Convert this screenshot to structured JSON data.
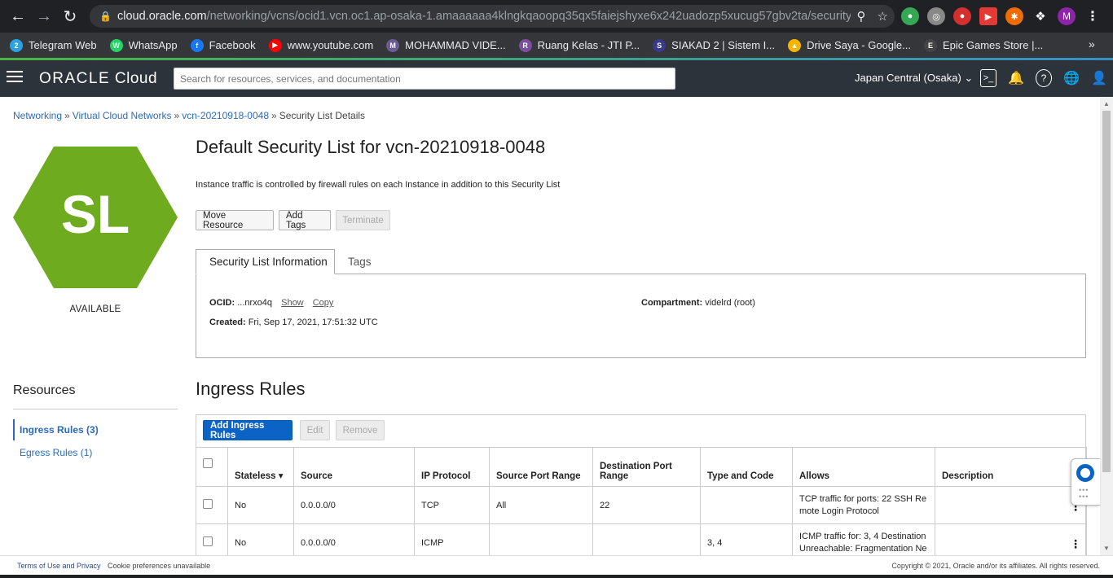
{
  "browser": {
    "url_host": "cloud.oracle.com",
    "url_path": "/networking/vcns/ocid1.vcn.oc1.ap-osaka-1.amaaaaaa4klngkqaoopq35qx5faiejshyxe6x242uadozp5xucug57gbv2ta/security-li...",
    "profile_initial": "M",
    "bookmarks": [
      {
        "label": "Telegram Web",
        "color": "#2aa3df",
        "glyph": "2"
      },
      {
        "label": "WhatsApp",
        "color": "#25d366",
        "glyph": "W"
      },
      {
        "label": "Facebook",
        "color": "#1877f2",
        "glyph": "f"
      },
      {
        "label": "www.youtube.com",
        "color": "#ff0000",
        "glyph": "▶"
      },
      {
        "label": "MOHAMMAD VIDE...",
        "color": "#6b5b95",
        "glyph": "M"
      },
      {
        "label": "Ruang Kelas - JTI P...",
        "color": "#7b4fa0",
        "glyph": "R"
      },
      {
        "label": "SIAKAD 2 | Sistem I...",
        "color": "#3a3a8a",
        "glyph": "S"
      },
      {
        "label": "Drive Saya - Google...",
        "color": "#f4b400",
        "glyph": "▲"
      },
      {
        "label": "Epic Games Store |...",
        "color": "#444",
        "glyph": "E"
      }
    ]
  },
  "header": {
    "logo_main": "ORACLE",
    "logo_sub": "Cloud",
    "search_placeholder": "Search for resources, services, and documentation",
    "region": "Japan Central (Osaka)"
  },
  "breadcrumb": {
    "items": [
      "Networking",
      "Virtual Cloud Networks",
      "vcn-20210918-0048"
    ],
    "current": "Security List Details"
  },
  "resource_icon": {
    "initials": "SL",
    "color": "#6fab1e",
    "status": "AVAILABLE"
  },
  "page": {
    "title": "Default Security List for vcn-20210918-0048",
    "description": "Instance traffic is controlled by firewall rules on each Instance in addition to this Security List",
    "actions": {
      "move": "Move Resource",
      "tags": "Add Tags",
      "terminate": "Terminate"
    }
  },
  "tabs": {
    "info": "Security List Information",
    "tags": "Tags"
  },
  "info": {
    "ocid_label": "OCID:",
    "ocid_value": "...nrxo4q",
    "show": "Show",
    "copy": "Copy",
    "created_label": "Created:",
    "created_value": "Fri, Sep 17, 2021, 17:51:32 UTC",
    "compartment_label": "Compartment:",
    "compartment_value": "videlrd (root)"
  },
  "resources": {
    "title": "Resources",
    "items": [
      "Ingress Rules (3)",
      "Egress Rules (1)"
    ]
  },
  "ingress": {
    "title": "Ingress Rules",
    "add": "Add Ingress Rules",
    "edit": "Edit",
    "remove": "Remove",
    "columns": [
      "Stateless",
      "Source",
      "IP Protocol",
      "Source Port Range",
      "Destination Port Range",
      "Type and Code",
      "Allows",
      "Description"
    ],
    "rows": [
      {
        "stateless": "No",
        "source": "0.0.0.0/0",
        "protocol": "TCP",
        "src_port": "All",
        "dst_port": "22",
        "type_code": "",
        "allows": "TCP traffic for ports: 22 SSH Re mote Login Protocol",
        "description": ""
      },
      {
        "stateless": "No",
        "source": "0.0.0.0/0",
        "protocol": "ICMP",
        "src_port": "",
        "dst_port": "",
        "type_code": "3, 4",
        "allows": "ICMP traffic for: 3, 4 Destination Unreachable: Fragmentation Ne",
        "description": ""
      }
    ]
  },
  "footer": {
    "terms": "Terms of Use and Privacy",
    "cookies": "Cookie preferences unavailable",
    "copyright": "Copyright © 2021, Oracle and/or its affiliates. All rights reserved."
  }
}
